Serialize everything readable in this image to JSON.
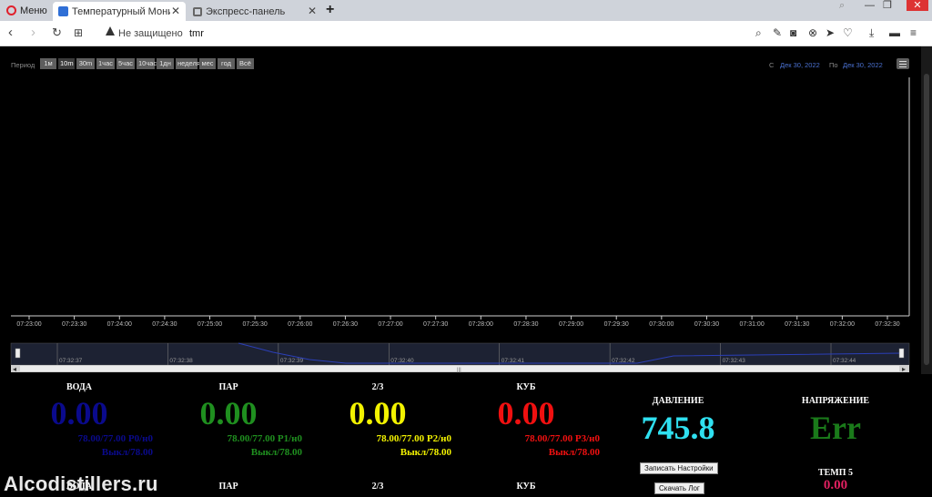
{
  "browser": {
    "menu_label": "Меню",
    "tabs": [
      {
        "title": "Температурный Монитор",
        "active": true
      },
      {
        "title": "Экспресс-панель",
        "active": false
      }
    ],
    "security_label": "Не защищено",
    "url": "tmr"
  },
  "chart": {
    "period_label": "Период",
    "period_buttons": [
      "1м",
      "10m",
      "30m",
      "1час",
      "5час",
      "10час",
      "1дн",
      "неделя",
      "мес",
      "год",
      "Всё"
    ],
    "selected_period": "10m",
    "range_from_label": "С",
    "range_from": "Дек 30, 2022",
    "range_to_label": "По",
    "range_to": "Дек 30, 2022"
  },
  "chart_data": {
    "type": "line",
    "title": "",
    "x_ticks": [
      "07:23:00",
      "07:23:30",
      "07:24:00",
      "07:24:30",
      "07:25:00",
      "07:25:30",
      "07:26:00",
      "07:26:30",
      "07:27:00",
      "07:27:30",
      "07:28:00",
      "07:28:30",
      "07:29:00",
      "07:29:30",
      "07:30:00",
      "07:30:30",
      "07:31:00",
      "07:31:30",
      "07:32:00",
      "07:32:30"
    ],
    "navigator_ticks": [
      "07:32:37",
      "07:32:38",
      "07:32:39",
      "07:32:40",
      "07:32:41",
      "07:32:42",
      "07:32:43",
      "07:32:44"
    ],
    "series": [],
    "grid": false
  },
  "sensors": [
    {
      "name": "ВОДА",
      "value": "0.00",
      "setting": "78.00/77.00 P0/н0",
      "state": "Выкл/78.00",
      "color": "#0a0a8c"
    },
    {
      "name": "ПАР",
      "value": "0.00",
      "setting": "78.00/77.00 P1/н0",
      "state": "Выкл/78.00",
      "color": "#1f8f1f"
    },
    {
      "name": "2/3",
      "value": "0.00",
      "setting": "78.00/77.00 P2/н0",
      "state": "Выкл/78.00",
      "color": "#f2f200"
    },
    {
      "name": "КУБ",
      "value": "0.00",
      "setting": "78.00/77.00 P3/н0",
      "state": "Выкл/78.00",
      "color": "#f01010"
    }
  ],
  "pressure": {
    "name": "ДАВЛЕНИЕ",
    "value": "745.8",
    "color": "#2fe0f0"
  },
  "voltage": {
    "name": "НАПРЯЖЕНИЕ",
    "value": "Err",
    "color": "#1a7a1a"
  },
  "temp5": {
    "name": "ТЕМП 5",
    "value": "0.00",
    "color": "#e02060"
  },
  "second_row": [
    "ВОДА",
    "ПАР",
    "2/3",
    "КУБ"
  ],
  "buttons": {
    "save_settings": "Записать Настройки",
    "download_log": "Скачать Лог"
  },
  "watermark": "Alcodistillers.ru"
}
